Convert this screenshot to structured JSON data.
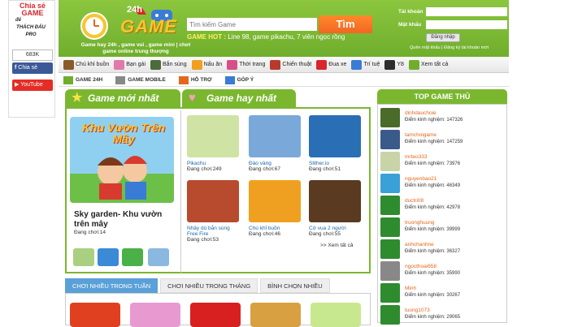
{
  "share": {
    "line1": "Chia sẻ",
    "line2": "GAME",
    "line3": "để",
    "line4": "THÁCH ĐẤU PRO",
    "count": "683K",
    "fb_label": "Chia sẻ",
    "yt_label": "YouTube"
  },
  "header": {
    "logo_text": "GAME",
    "logo_badge": "24h",
    "tagline": "Game hay 24h , game vui , game mini | chơi game online trung thượng",
    "search_placeholder": "Tìm kiếm Game",
    "search_button": "Tìm",
    "hot_label": "GAME HOT :",
    "hot_text": "Line 98, game pikachu, 7 viên ngọc rồng",
    "login": {
      "user_label": "Tài khoản",
      "pass_label": "Mật khẩu",
      "button": "Đăng nhập",
      "links": "Quên mật khẩu | Đăng ký tài khoản mới"
    }
  },
  "categories": [
    {
      "label": "Chú khỉ buồn",
      "color": "#8a5a2b"
    },
    {
      "label": "Bạn gái",
      "color": "#e07aa8"
    },
    {
      "label": "Bắn súng",
      "color": "#4b6b3a"
    },
    {
      "label": "Nấu ăn",
      "color": "#f0a020"
    },
    {
      "label": "Thời trang",
      "color": "#d64f8a"
    },
    {
      "label": "Chiến thuật",
      "color": "#b83a2e"
    },
    {
      "label": "Đua xe",
      "color": "#d8262b"
    },
    {
      "label": "Trí tuệ",
      "color": "#3a7bd5"
    },
    {
      "label": "Y8",
      "color": "#2d2d2d"
    },
    {
      "label": "Xem tất cả",
      "color": "#6fae2c"
    }
  ],
  "subnav": [
    {
      "label": "GAME 24H",
      "color": "#6fae2c"
    },
    {
      "label": "GAME MOBILE",
      "color": "#888888"
    },
    {
      "label": "HỖ TRỢ",
      "color": "#e5671d"
    },
    {
      "label": "GÓP Ý",
      "color": "#3a7bd5"
    }
  ],
  "sections": {
    "new_games": "Game mới nhất",
    "hot_games": "Game hay nhất"
  },
  "featured": {
    "banner": "Khu Vườn Trên Mây",
    "title": "Sky garden- Khu vườn trên mây",
    "plays": "Đang chơi:14"
  },
  "games": [
    {
      "name": "Pikachu",
      "plays": "Đang chơi:249",
      "color": "#cfe3a4"
    },
    {
      "name": "Đào vàng",
      "plays": "Đang chơi:67",
      "color": "#7aa8d8"
    },
    {
      "name": "Slither.io",
      "plays": "Đang chơi:51",
      "color": "#2a6fb5"
    },
    {
      "name": "Nhảy dù bắn súng Free Fire",
      "plays": "Đang chơi:53",
      "color": "#b84a2e"
    },
    {
      "name": "Chú khỉ buồn",
      "plays": "Đang chơi:46",
      "color": "#f0a020"
    },
    {
      "name": "Cờ vua 2 người",
      "plays": "Đang chơi:55",
      "color": "#5a3a20"
    }
  ],
  "more_link": ">> Xem tất cả",
  "tabs": [
    "CHƠI NHIỀU TRONG TUẦN",
    "CHƠI NHIỀU TRONG THÁNG",
    "BÌNH CHỌN NHIỀU"
  ],
  "top_players": {
    "heading": "TOP GAME THỦ",
    "players": [
      {
        "name": "dinhdauchoie",
        "score": "Điểm kinh nghiệm: 147326",
        "color": "#4a6b2a"
      },
      {
        "name": "tamchoigame",
        "score": "Điểm kinh nghiệm: 147259",
        "color": "#3a5a8a"
      },
      {
        "name": "mrteo333",
        "score": "Điểm kinh nghiệm: 73976",
        "color": "#c8d4a8"
      },
      {
        "name": "nguyenbao21",
        "score": "Điểm kinh nghiệm: 46349",
        "color": "#3aa0d8"
      },
      {
        "name": "ductri08",
        "score": "Điểm kinh nghiệm: 42978",
        "color": "#2e8b2e"
      },
      {
        "name": "truonghuung",
        "score": "Điểm kinh nghiệm: 39999",
        "color": "#2e8b2e"
      },
      {
        "name": "anhchanhne",
        "score": "Điểm kinh nghiệm: 36327",
        "color": "#2e8b2e"
      },
      {
        "name": "ngocthoai658",
        "score": "Điểm kinh nghiệm: 35990",
        "color": "#888888"
      },
      {
        "name": "Minh",
        "score": "Điểm kinh nghiệm: 30267",
        "color": "#2e8b2e"
      },
      {
        "name": "tuong1073",
        "score": "Điểm kinh nghiệm: 29065",
        "color": "#2e8b2e"
      }
    ]
  }
}
